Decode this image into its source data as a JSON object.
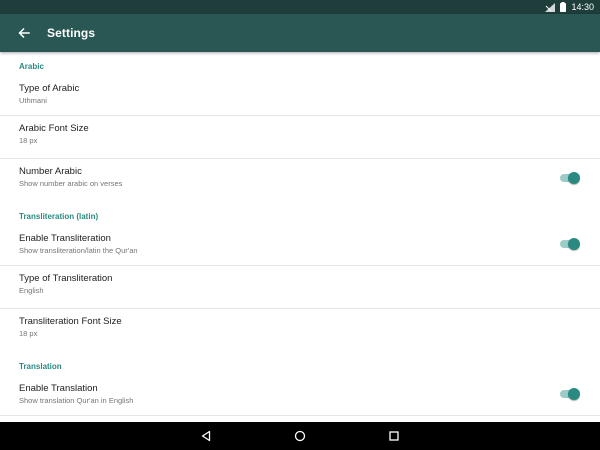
{
  "status_bar": {
    "time": "14:30",
    "icons": [
      "signal-icon",
      "battery-icon"
    ]
  },
  "app_bar": {
    "title": "Settings",
    "back_icon": "arrow-left-icon"
  },
  "sections": [
    {
      "header": "Arabic",
      "items": [
        {
          "title": "Type of Arabic",
          "summary": "Uthmani"
        },
        {
          "title": "Arabic Font Size",
          "summary": "18 px"
        },
        {
          "title": "Number Arabic",
          "summary": "Show number arabic on verses",
          "switch_on": true
        }
      ]
    },
    {
      "header": "Transliteration (latin)",
      "items": [
        {
          "title": "Enable Transliteration",
          "summary": "Show transliteration/latin the Qur'an",
          "switch_on": true
        },
        {
          "title": "Type of Transliteration",
          "summary": "English"
        },
        {
          "title": "Transliteration Font Size",
          "summary": "18 px"
        }
      ]
    },
    {
      "header": "Translation",
      "items": [
        {
          "title": "Enable Translation",
          "summary": "Show translation Qur'an in English",
          "switch_on": true
        }
      ]
    }
  ],
  "colors": {
    "app_bar": "#295754",
    "status_bar": "#1f3e3b",
    "accent": "#2a8a82",
    "switch_track": "#9cccc7"
  },
  "nav_bar": {
    "icons": [
      "back-triangle-icon",
      "home-circle-icon",
      "recents-square-icon"
    ]
  }
}
